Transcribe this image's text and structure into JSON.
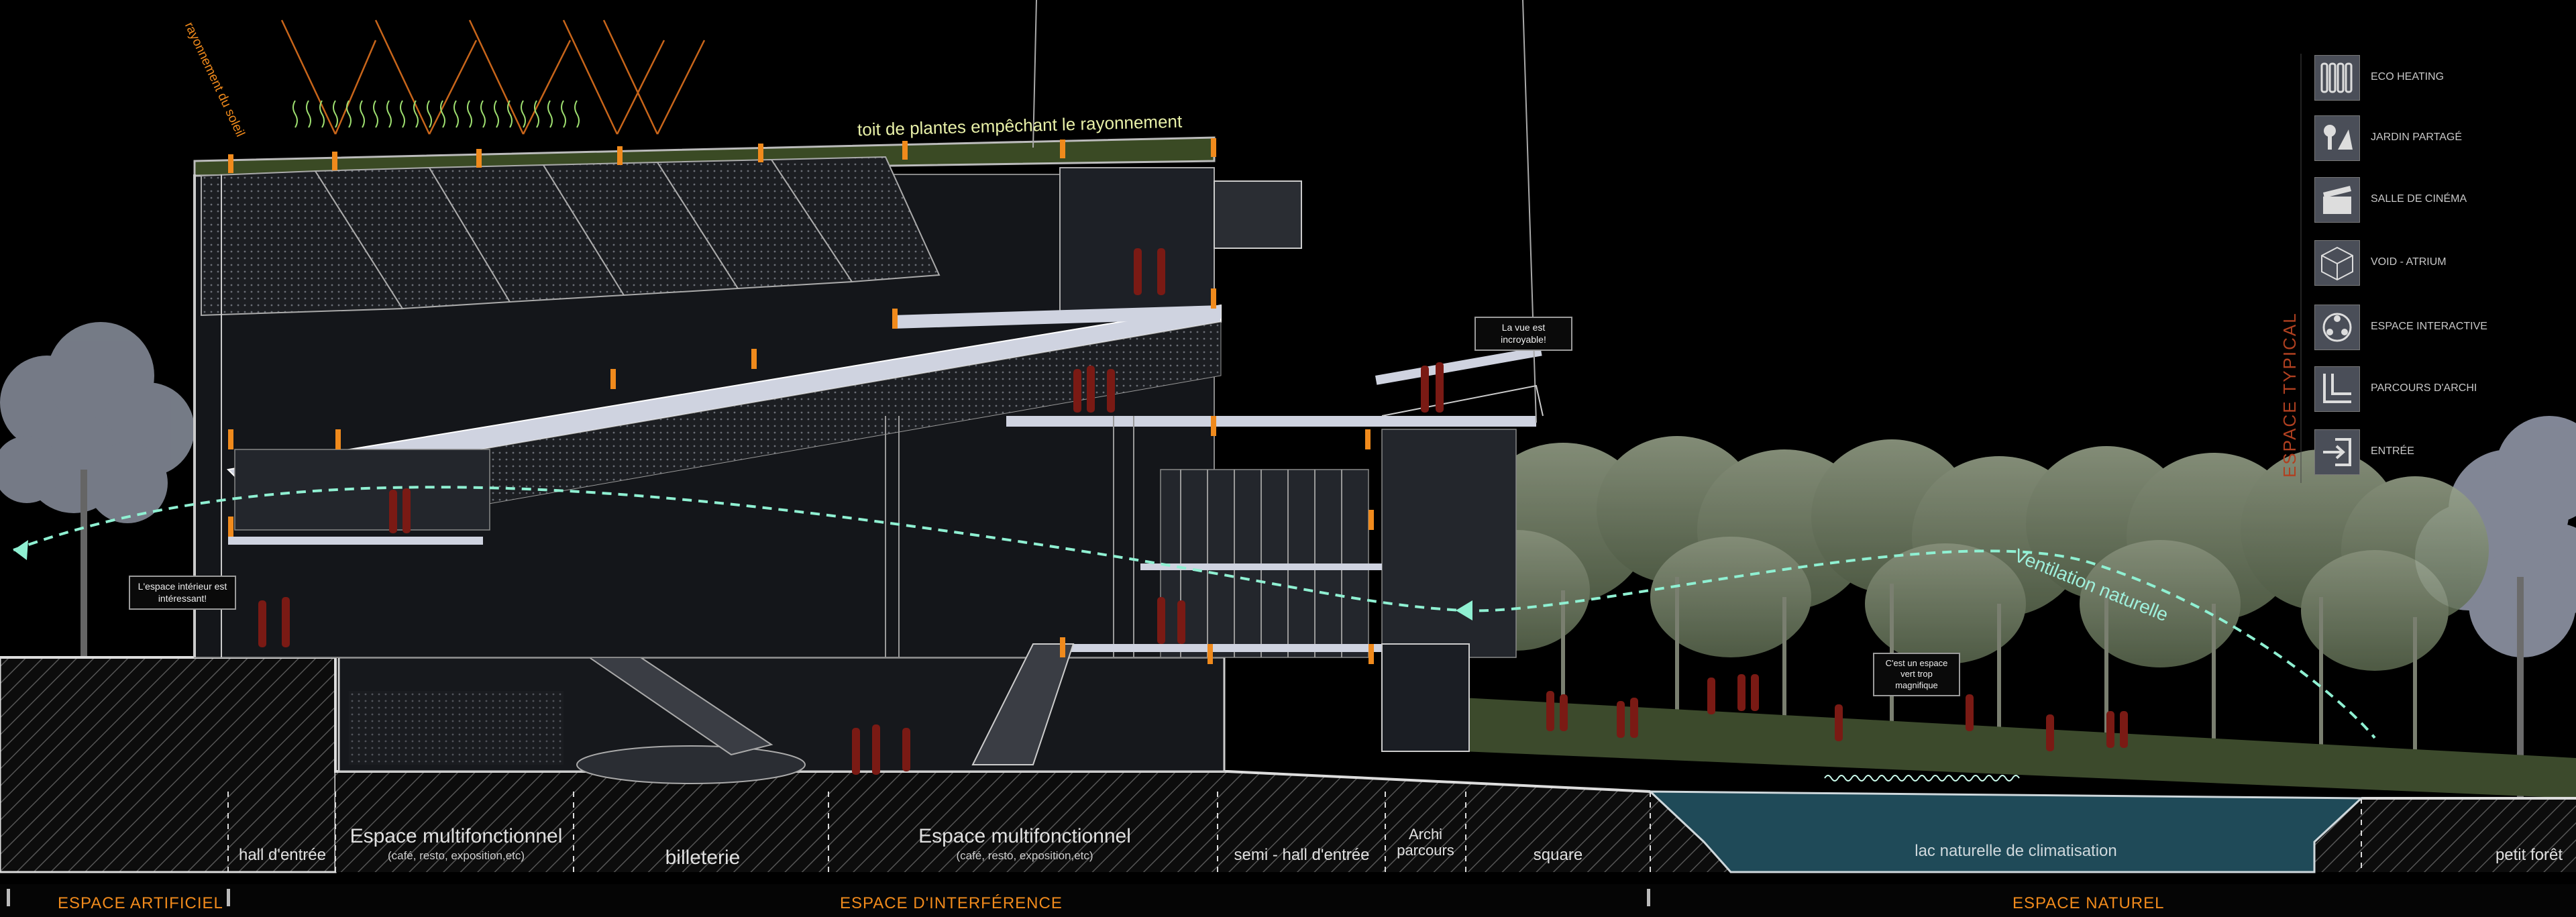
{
  "annotations": {
    "roof": "toit de plantes empêchant le rayonnement",
    "solar": "rayonnement du soleil",
    "ventilation": "Ventilation naturelle"
  },
  "bubbles": {
    "view": "La vue est incroyable!",
    "interior": "L'espace intérieur est intéressant!",
    "space": "C'est un espace vert trop magnifique"
  },
  "zones": {
    "hall": "hall d'entrée",
    "multi1_title": "Espace multifonctionnel",
    "multi1_sub": "(café, resto, exposition,etc)",
    "billeterie": "billeterie",
    "multi2_title": "Espace multifonctionnel",
    "multi2_sub": "(café, resto, exposition,etc)",
    "semihall": "semi - hall d'entrée",
    "archi": "Archi parcours",
    "square": "square",
    "lac": "lac naturelle de climatisation",
    "foret": "petit forêt"
  },
  "bands": {
    "artificiel": "ESPACE ARTIFICIEL",
    "interference": "ESPACE D'INTERFÉRENCE",
    "naturel": "ESPACE NATUREL"
  },
  "legend": {
    "title": "ESPACE TYPICAL",
    "items": [
      {
        "label": "ECO HEATING",
        "icon": "radiator-icon"
      },
      {
        "label": "JARDIN PARTAGÉ",
        "icon": "garden-icon"
      },
      {
        "label": "SALLE DE CINÉMA",
        "icon": "clapperboard-icon"
      },
      {
        "label": "VOID - ATRIUM",
        "icon": "cube-icon"
      },
      {
        "label": "ESPACE INTERACTIVE",
        "icon": "interactive-icon"
      },
      {
        "label": "PARCOURS D'ARCHI",
        "icon": "path-icon"
      },
      {
        "label": "ENTRÉE",
        "icon": "entrance-icon"
      }
    ]
  },
  "colors": {
    "accent": "#f08a1c",
    "ventilation": "#8ff0d2",
    "water": "#1f4a58",
    "grass": "#3c4a2c",
    "people": "#7a1a14"
  }
}
